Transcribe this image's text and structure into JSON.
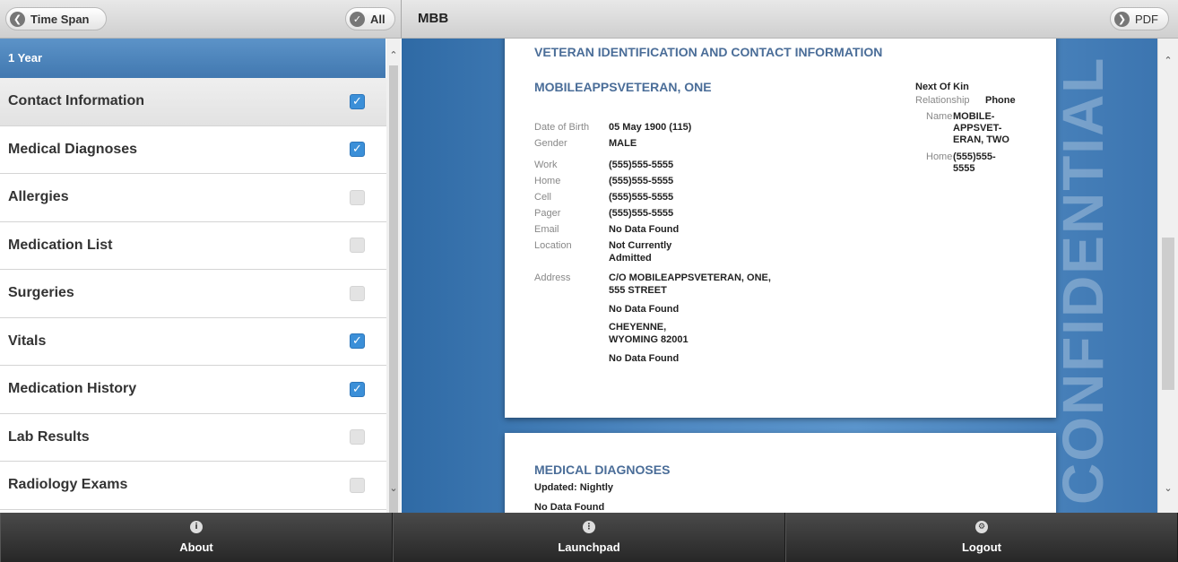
{
  "topbar": {
    "time_span_label": "Time Span",
    "all_label": "All",
    "title": "MBB",
    "pdf_label": "PDF"
  },
  "sidebar": {
    "year_header": "1 Year",
    "items": [
      {
        "label": "Contact Information",
        "checked": true
      },
      {
        "label": "Medical Diagnoses",
        "checked": true
      },
      {
        "label": "Allergies",
        "checked": false
      },
      {
        "label": "Medication List",
        "checked": false
      },
      {
        "label": "Surgeries",
        "checked": false
      },
      {
        "label": "Vitals",
        "checked": true
      },
      {
        "label": "Medication History",
        "checked": true
      },
      {
        "label": "Lab Results",
        "checked": false
      },
      {
        "label": "Radiology Exams",
        "checked": false
      }
    ]
  },
  "document": {
    "section1_title": "VETERAN IDENTIFICATION AND CONTACT INFORMATION",
    "patient_name": "MOBILEAPPSVETERAN, ONE",
    "fields": {
      "dob_label": "Date of Birth",
      "dob_value": "05 May 1900 (115)",
      "gender_label": "Gender",
      "gender_value": "MALE",
      "work_label": "Work",
      "work_value": "(555)555-5555",
      "home_label": "Home",
      "home_value": "(555)555-5555",
      "cell_label": "Cell",
      "cell_value": "(555)555-5555",
      "pager_label": "Pager",
      "pager_value": "(555)555-5555",
      "email_label": "Email",
      "email_value": "No Data Found",
      "location_label": "Location",
      "location_value_1": "Not Currently",
      "location_value_2": "Admitted",
      "address_label": "Address",
      "address_1": "C/O MOBILEAPPSVETERAN, ONE,",
      "address_2": "555 STREET",
      "address_3": "No Data Found",
      "address_4": "CHEYENNE,",
      "address_5": "WYOMING 82001",
      "address_6": "No Data Found"
    },
    "next_of_kin": {
      "title": "Next Of Kin",
      "relationship_label": "Relationship",
      "relationship_value": "Phone",
      "name_label": "Name",
      "name_value_1": "MOBILE-",
      "name_value_2": "APPSVET-",
      "name_value_3": "ERAN, TWO",
      "home_label": "Home",
      "home_value_1": "(555)555-",
      "home_value_2": "5555"
    },
    "watermark": "CONFIDENTIAL",
    "section2_title": "MEDICAL DIAGNOSES",
    "section2_updated": "Updated: Nightly",
    "section2_nodata": "No Data Found"
  },
  "bottombar": {
    "about_label": "About",
    "launchpad_label": "Launchpad",
    "logout_label": "Logout"
  }
}
